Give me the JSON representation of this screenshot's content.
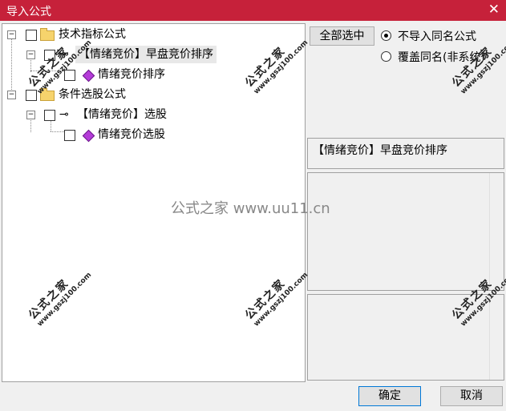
{
  "window": {
    "title": "导入公式",
    "close_glyph": "✕"
  },
  "tree": {
    "node_tech": "技术指标公式",
    "node_tech_formula": "【情绪竞价】早盘竞价排序",
    "node_tech_leaf": "情绪竞价排序",
    "node_cond": "条件选股公式",
    "node_cond_formula": "【情绪竞价】选股",
    "node_cond_leaf": "情绪竞价选股",
    "expander_minus": "−",
    "key_glyph": "⊸"
  },
  "options": {
    "select_all_label": "全部选中",
    "radio_skip_label": "不导入同名公式",
    "radio_overwrite_label": "覆盖同名(非系统)",
    "radio_skip_selected": true,
    "radio_overwrite_selected": false
  },
  "info": {
    "selected_formula": "【情绪竞价】早盘竞价排序"
  },
  "buttons": {
    "ok_label": "确定",
    "cancel_label": "取消"
  },
  "watermark": {
    "text": "公式之家",
    "url": "www.gszj100.com",
    "center_text": "公式之家 www.uu11.cn"
  }
}
